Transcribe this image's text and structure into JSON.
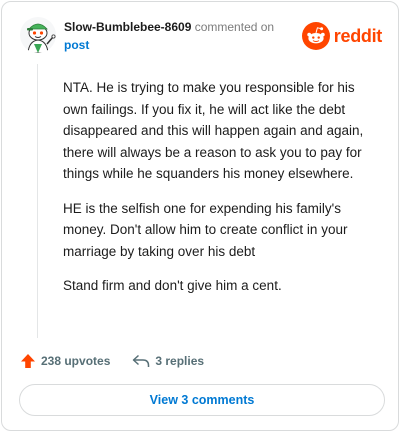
{
  "comment": {
    "username": "Slow-Bumblebee-8609",
    "commented_text": "commented on",
    "post_link": "post",
    "paragraphs": [
      "NTA. He is trying to make you responsible for his own failings. If you fix it, he will act like the debt disappeared and this will happen again and again, there will always be a reason to ask you to pay for things while he squanders his money elsewhere.",
      "HE is the selfish one for expending his family's money. Don't allow him to create conflict in your marriage by taking over his debt",
      "Stand firm and don't give him a cent."
    ]
  },
  "brand": {
    "wordmark": "reddit",
    "color": "#ff4500"
  },
  "actions": {
    "upvotes": "238 upvotes",
    "replies": "3 replies"
  },
  "view_button": {
    "label": "View 3 comments"
  },
  "icons": {
    "avatar": "snoo-avatar-icon",
    "logo": "reddit-snoo-icon",
    "upvote": "upvote-arrow-icon",
    "reply": "reply-arrow-icon"
  }
}
